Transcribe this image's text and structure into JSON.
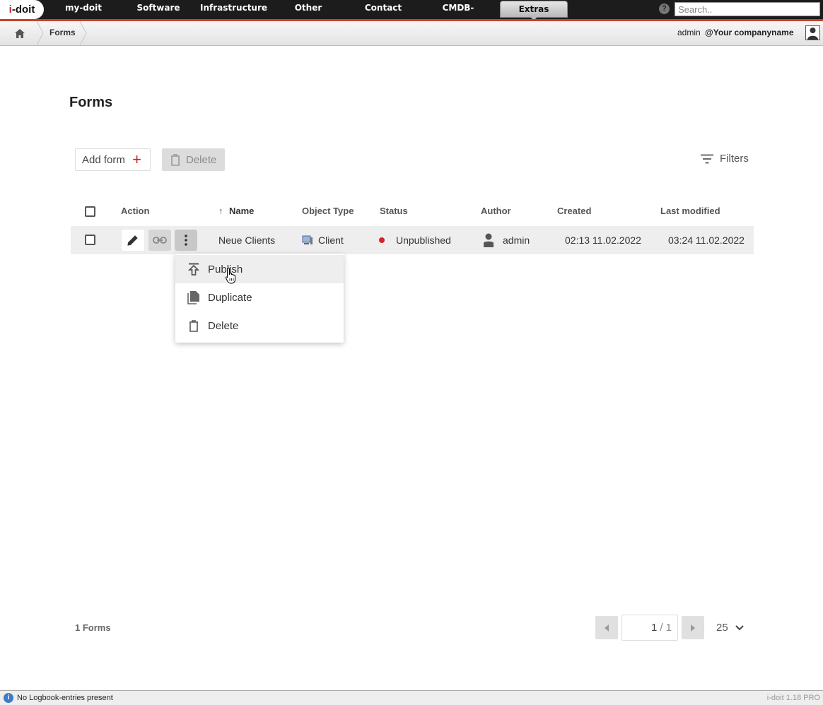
{
  "app": {
    "logo_text": "i-doit"
  },
  "nav": {
    "items": [
      "my-doit",
      "Software",
      "Infrastructure",
      "Other",
      "Contact",
      "CMDB-Explorer",
      "Extras"
    ],
    "active": "Extras",
    "search_placeholder": "Search.."
  },
  "breadcrumb": {
    "current": "Forms"
  },
  "user": {
    "name": "admin",
    "company": "@Your companyname"
  },
  "page": {
    "title": "Forms"
  },
  "toolbar": {
    "add_label": "Add form",
    "delete_label": "Delete",
    "filters_label": "Filters"
  },
  "table": {
    "columns": {
      "action": "Action",
      "name": "Name",
      "object_type": "Object Type",
      "status": "Status",
      "author": "Author",
      "created": "Created",
      "last_modified": "Last modified"
    },
    "sort": {
      "column": "Name",
      "direction": "ascending"
    },
    "rows": [
      {
        "name": "Neue Clients",
        "object_type": "Client",
        "status": "Unpublished",
        "author": "admin",
        "created": "02:13 11.02.2022",
        "last_modified": "03:24 11.02.2022"
      }
    ]
  },
  "menu": {
    "items": [
      "Publish",
      "Duplicate",
      "Delete"
    ],
    "hovered": "Publish"
  },
  "footer": {
    "count": "1 Forms",
    "page_current": "1",
    "page_total": "/ 1",
    "per_page": "25"
  },
  "statusbar": {
    "text": "No Logbook-entries present",
    "version": "i-doit 1.18 PRO"
  },
  "colors": {
    "accent": "#c0262d",
    "nav_bg": "#1c1c1c",
    "status_unpublished": "#e02020",
    "info": "#3d7bc4"
  }
}
